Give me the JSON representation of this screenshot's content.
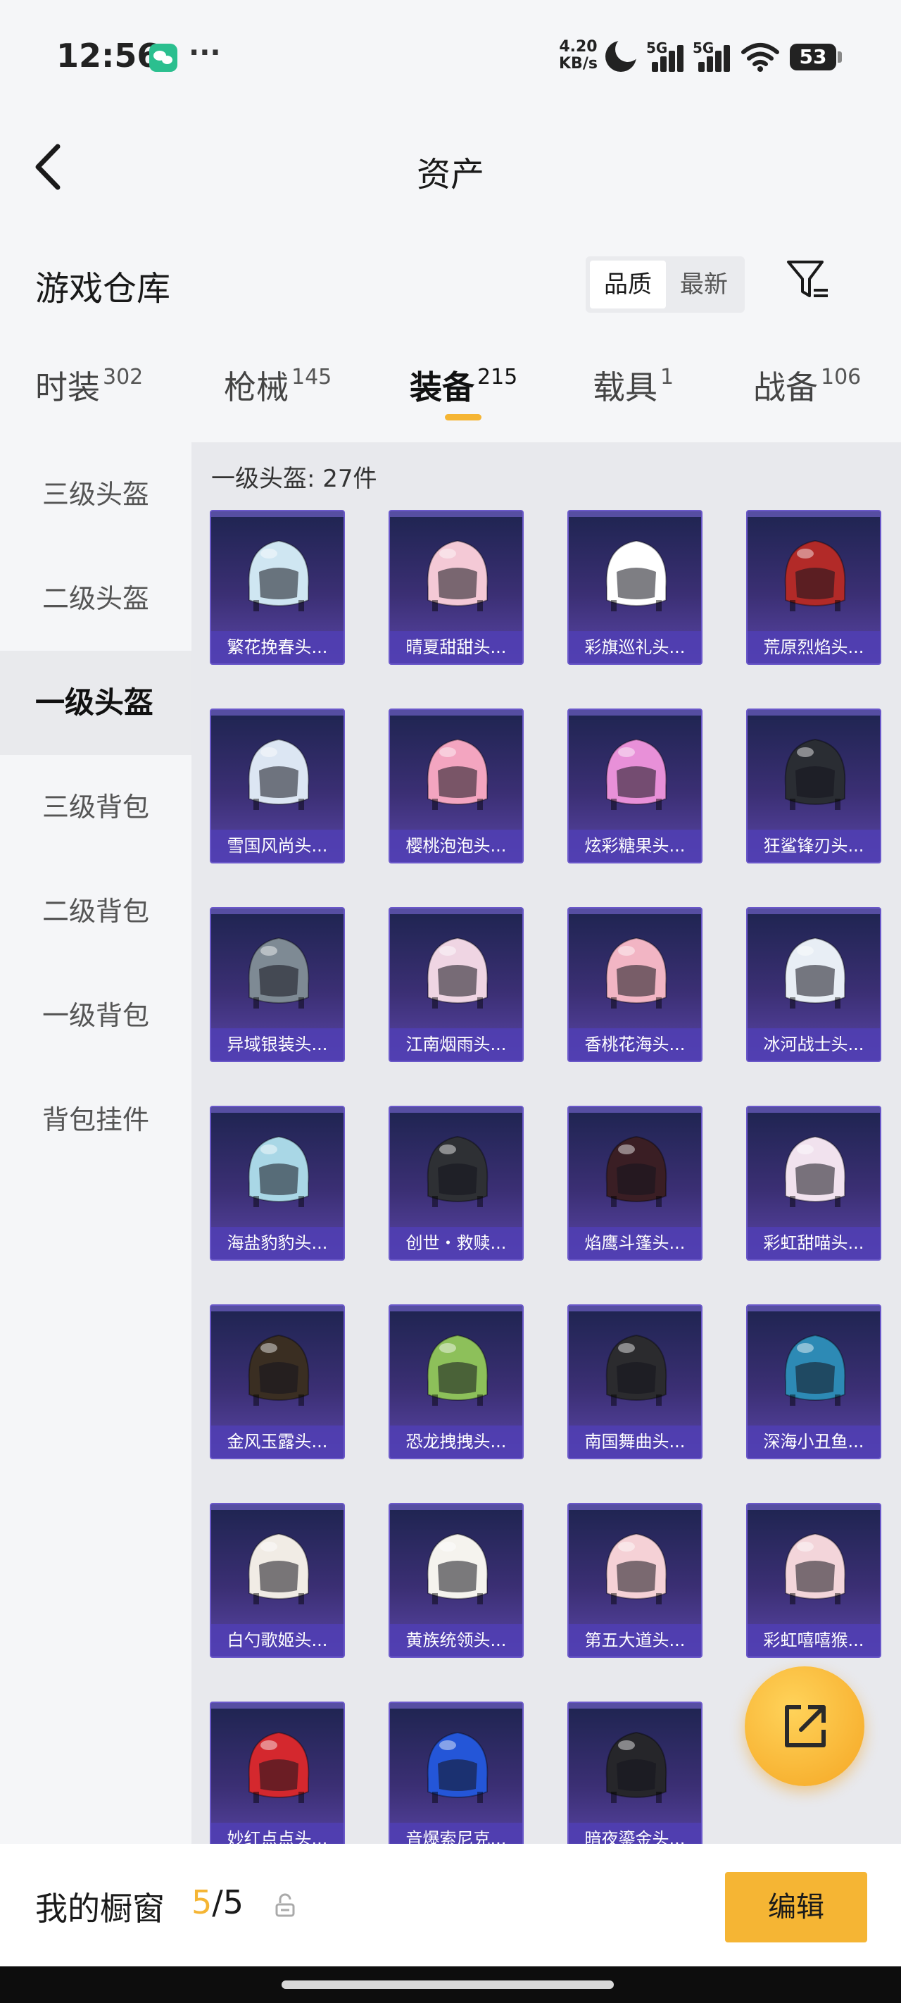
{
  "status_bar": {
    "time": "12:56",
    "more": "···",
    "net_speed_value": "4.20",
    "net_speed_unit": "KB/s",
    "signal_1": "5G",
    "signal_2": "5G",
    "battery": "53",
    "icons": [
      "wechat-icon",
      "moon-icon",
      "signal-icon",
      "wifi-icon",
      "battery-icon"
    ]
  },
  "nav": {
    "title": "资产",
    "back_icon": "chevron-left-icon"
  },
  "header": {
    "title": "游戏仓库",
    "sort_options": [
      "品质",
      "最新"
    ],
    "sort_selected": "品质",
    "filter_icon": "filter-icon"
  },
  "tabs": [
    {
      "label": "时装",
      "count": "302"
    },
    {
      "label": "枪械",
      "count": "145"
    },
    {
      "label": "装备",
      "count": "215",
      "active": true
    },
    {
      "label": "载具",
      "count": "1"
    },
    {
      "label": "战备",
      "count": "106"
    }
  ],
  "sidebar": [
    {
      "label": "三级头盔"
    },
    {
      "label": "二级头盔"
    },
    {
      "label": "一级头盔",
      "active": true
    },
    {
      "label": "三级背包"
    },
    {
      "label": "二级背包"
    },
    {
      "label": "一级背包"
    },
    {
      "label": "背包挂件"
    }
  ],
  "content": {
    "group_title": "一级头盔: 27件",
    "items": [
      {
        "name": "繁花挽春头...",
        "color": "#cfe6f2"
      },
      {
        "name": "晴夏甜甜头...",
        "color": "#f4c9d6"
      },
      {
        "name": "彩旗巡礼头...",
        "color": "#ffffff"
      },
      {
        "name": "荒原烈焰头...",
        "color": "#b22a28"
      },
      {
        "name": "雪国风尚头...",
        "color": "#dce6f3"
      },
      {
        "name": "樱桃泡泡头...",
        "color": "#f3a5c0"
      },
      {
        "name": "炫彩糖果头...",
        "color": "#e890d8"
      },
      {
        "name": "狂鲨锋刃头...",
        "color": "#2a2d33"
      },
      {
        "name": "异域银装头...",
        "color": "#7e8a94"
      },
      {
        "name": "江南烟雨头...",
        "color": "#efd5e3"
      },
      {
        "name": "香桃花海头...",
        "color": "#f2b5c4"
      },
      {
        "name": "冰河战士头...",
        "color": "#e8eef5"
      },
      {
        "name": "海盐豹豹头...",
        "color": "#a9d7e6"
      },
      {
        "name": "创世・救赎...",
        "color": "#2e3034"
      },
      {
        "name": "焰鹰斗篷头...",
        "color": "#3a1e24"
      },
      {
        "name": "彩虹甜喵头...",
        "color": "#f1e2ee"
      },
      {
        "name": "金风玉露头...",
        "color": "#3a2e22"
      },
      {
        "name": "恐龙拽拽头...",
        "color": "#8dc05a"
      },
      {
        "name": "南国舞曲头...",
        "color": "#2b2b2e"
      },
      {
        "name": "深海小丑鱼...",
        "color": "#2d8ab5"
      },
      {
        "name": "白勺歌姬头...",
        "color": "#f1ece5"
      },
      {
        "name": "黄族统领头...",
        "color": "#f5f3ee"
      },
      {
        "name": "第五大道头...",
        "color": "#f5d1d6"
      },
      {
        "name": "彩虹嘻嘻猴...",
        "color": "#f3d5da"
      },
      {
        "name": "妙红点点头...",
        "color": "#d4282e"
      },
      {
        "name": "音爆索尼克...",
        "color": "#2456d8"
      },
      {
        "name": "暗夜鎏金头...",
        "color": "#26262a"
      }
    ]
  },
  "float_button": {
    "icon": "share-icon"
  },
  "bottom": {
    "showcase_label": "我的橱窗",
    "showcase_current": "5",
    "showcase_total": "/5",
    "lock_icon": "lock-icon",
    "edit_label": "编辑"
  },
  "colors": {
    "accent": "#f5b534",
    "card_bg": "#3b2f74",
    "card_label_bg": "#503eb4"
  }
}
